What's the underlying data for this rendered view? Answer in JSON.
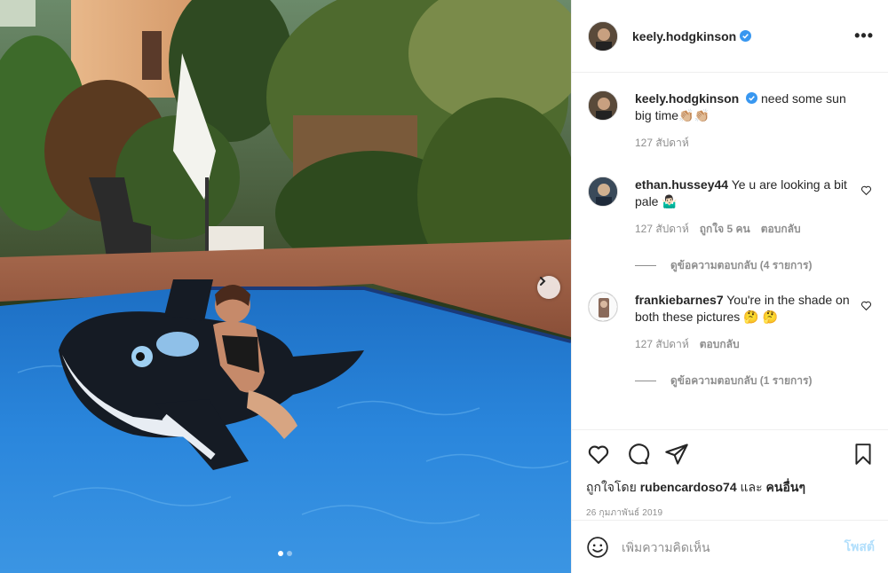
{
  "post": {
    "author": "keely.hodgkinson",
    "more_label": "•••",
    "caption_text": "need some sun big time👏🏼👏🏼",
    "caption_time": "127 สัปดาห์"
  },
  "comments": [
    {
      "user": "ethan.hussey44",
      "text": "Ye u are looking a bit pale 🤷🏻‍♂️",
      "time": "127 สัปดาห์",
      "likes": "ถูกใจ 5 คน",
      "reply": "ตอบกลับ",
      "view_replies": "ดูข้อความตอบกลับ (4 รายการ)"
    },
    {
      "user": "frankiebarnes7",
      "text": "You're in the shade on both these pictures 🤔 🤔",
      "time": "127 สัปดาห์",
      "reply": "ตอบกลับ",
      "view_replies": "ดูข้อความตอบกลับ (1 รายการ)"
    }
  ],
  "likes": {
    "prefix": "ถูกใจโดย",
    "user": "rubencardoso74",
    "suffix": "และ",
    "others": "คนอื่นๆ"
  },
  "date": "26 กุมภาพันธ์ 2019",
  "add_comment": {
    "placeholder": "เพิ่มความคิดเห็น",
    "post_label": "โพสต์"
  },
  "carousel": {
    "count": 2,
    "active_index": 0
  },
  "icons": {
    "verified": "verified-badge-icon",
    "like": "heart-icon",
    "comment": "comment-icon",
    "share": "paper-plane-icon",
    "save": "bookmark-icon",
    "emoji": "smiley-icon",
    "next": "chevron-right-icon"
  },
  "colors": {
    "verified": "#3897f0",
    "post_button": "#b2dffc",
    "secondary_text": "#8e8e8e"
  }
}
